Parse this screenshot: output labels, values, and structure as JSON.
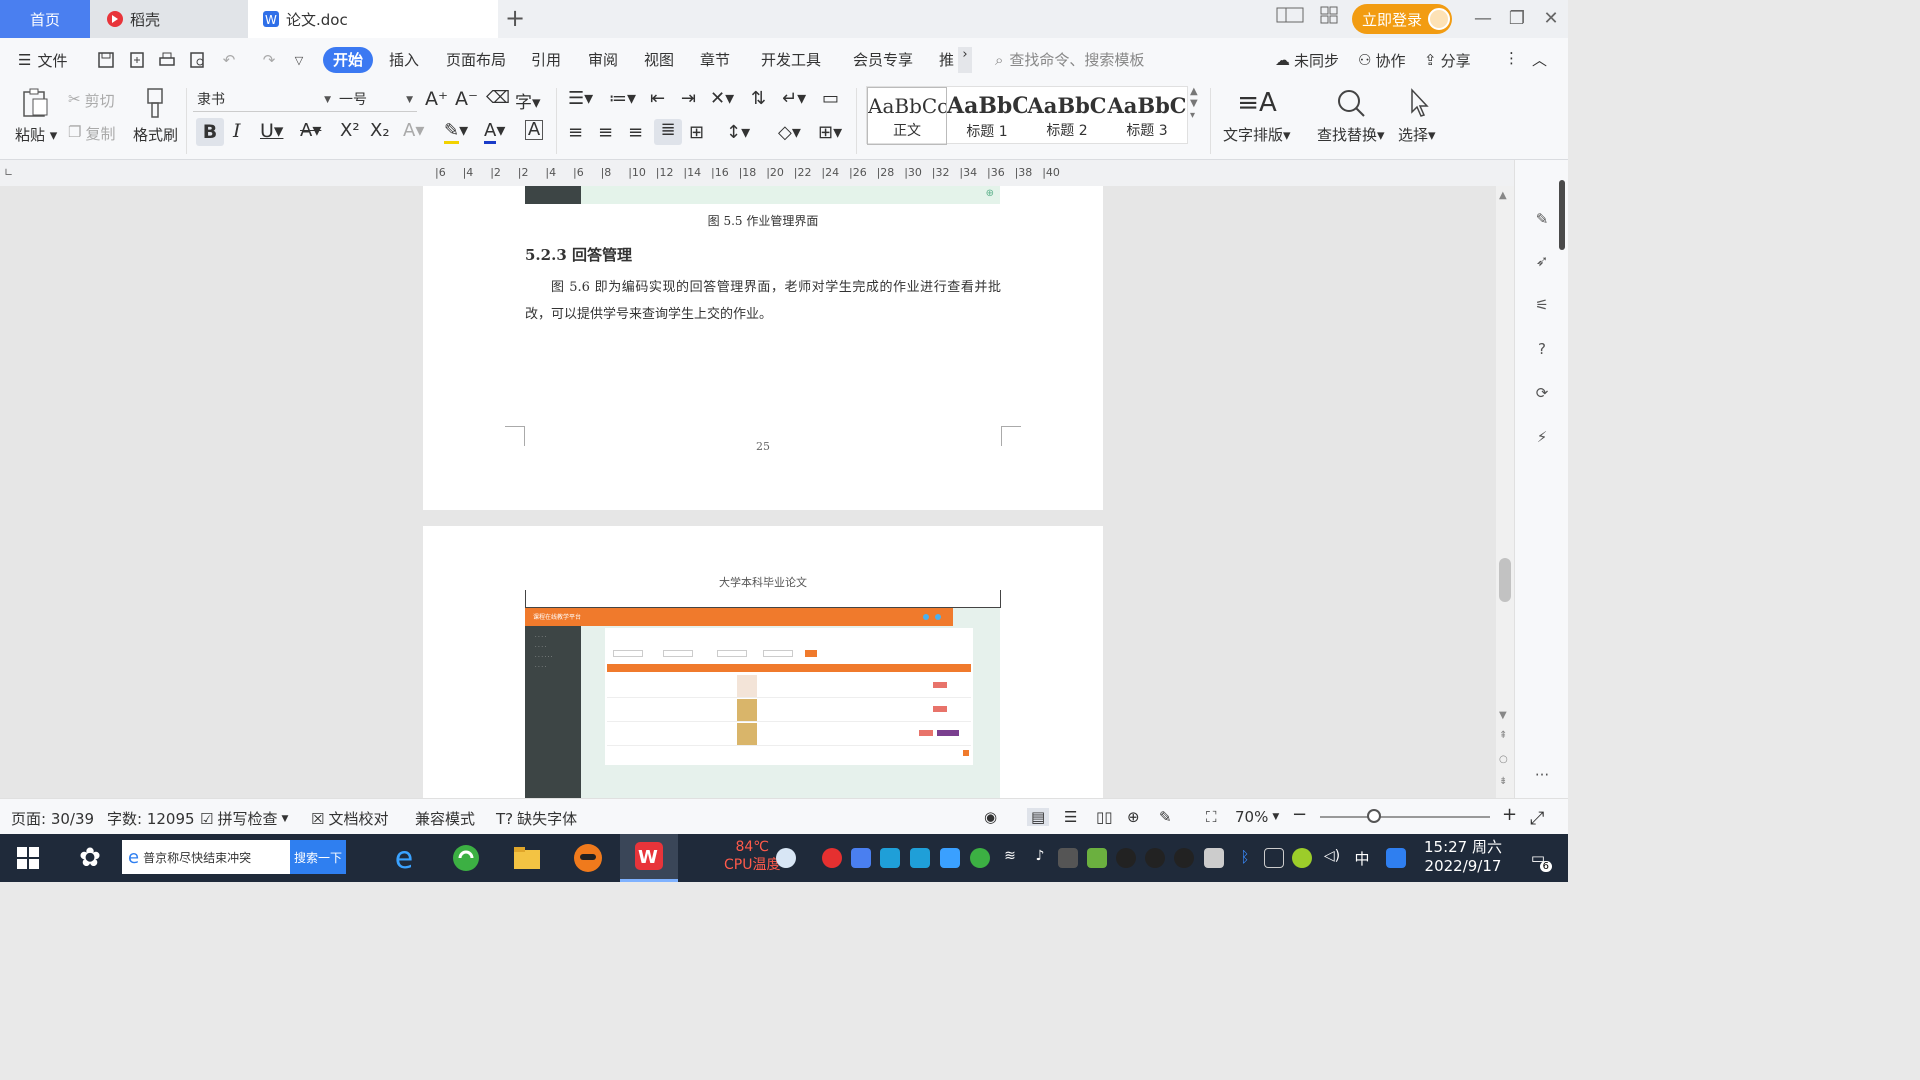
{
  "tabs": {
    "home": "首页",
    "daoke": "稻壳",
    "doc": "论文.doc",
    "add": "+"
  },
  "titlebar": {
    "login": "立即登录"
  },
  "menu": {
    "file": "文件",
    "items": [
      "开始",
      "插入",
      "页面布局",
      "引用",
      "审阅",
      "视图",
      "章节",
      "开发工具",
      "会员专享",
      "推"
    ],
    "search_placeholder": "查找命令、搜索模板",
    "sync": "未同步",
    "collab": "协作",
    "share": "分享"
  },
  "ribbon": {
    "paste": "粘贴",
    "cut": "剪切",
    "copy": "复制",
    "format_painter": "格式刷",
    "font": "隶书",
    "size": "一号",
    "styles": [
      {
        "sample": "AaBbCcI",
        "name": "正文"
      },
      {
        "sample": "AaBbC",
        "name": "标题 1"
      },
      {
        "sample": "AaBbC",
        "name": "标题 2"
      },
      {
        "sample": "AaBbC",
        "name": "标题 3"
      }
    ],
    "text_layout": "文字排版",
    "find_replace": "查找替换",
    "select": "选择"
  },
  "ruler": [
    "6",
    "4",
    "2",
    "2",
    "4",
    "6",
    "8",
    "10",
    "12",
    "14",
    "16",
    "18",
    "20",
    "22",
    "24",
    "26",
    "28",
    "30",
    "32",
    "34",
    "36",
    "38",
    "40"
  ],
  "document": {
    "caption": "图 5.5  作业管理界面",
    "heading": "5.2.3  回答管理",
    "paragraph": "图 5.6 即为编码实现的回答管理界面，老师对学生完成的作业进行查看并批改，可以提供学号来查询学生上交的作业。",
    "page_number": "25",
    "page2_header": "大学本科毕业论文",
    "screenshot_title": "课程在线教学平台"
  },
  "status": {
    "page": "页面: 30/39",
    "words": "字数: 12095",
    "spell": "拼写检查",
    "proof": "文档校对",
    "compat": "兼容模式",
    "missing_font": "缺失字体",
    "zoom": "70%"
  },
  "taskbar": {
    "search_text": "普京称尽快结束冲突",
    "search_btn": "搜索一下",
    "cpu_temp": "84℃",
    "cpu_label": "CPU温度",
    "ime": "中",
    "time": "15:27 周六",
    "date": "2022/9/17",
    "notif_count": "6"
  },
  "colors": {
    "accent": "#3b79f2",
    "home_tab": "#4a7ff0",
    "login": "#f29c12",
    "taskbar": "#1f2a3a",
    "screenshot_orange": "#f07a2c"
  }
}
